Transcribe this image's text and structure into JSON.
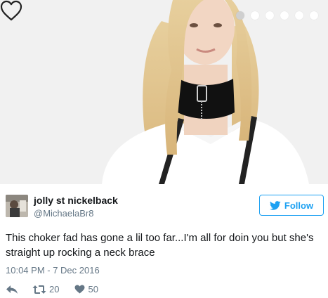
{
  "photo": {
    "carousel_dots": 6,
    "active_dot": 0,
    "heart_icon": "heart-outline-icon"
  },
  "tweet": {
    "display_name": "jolly st nickelback",
    "handle": "@MichaelaBr8",
    "follow_label": "Follow",
    "follow_icon": "twitter-bird-icon",
    "text": "This choker fad has gone a lil too far...I'm all for doin you but she's straight up rocking a neck brace",
    "timestamp": "10:04 PM - 7 Dec 2016",
    "retweet_count": "20",
    "like_count": "50"
  },
  "colors": {
    "twitter_blue": "#1da1f2",
    "text": "#14171a",
    "secondary": "#657786"
  }
}
